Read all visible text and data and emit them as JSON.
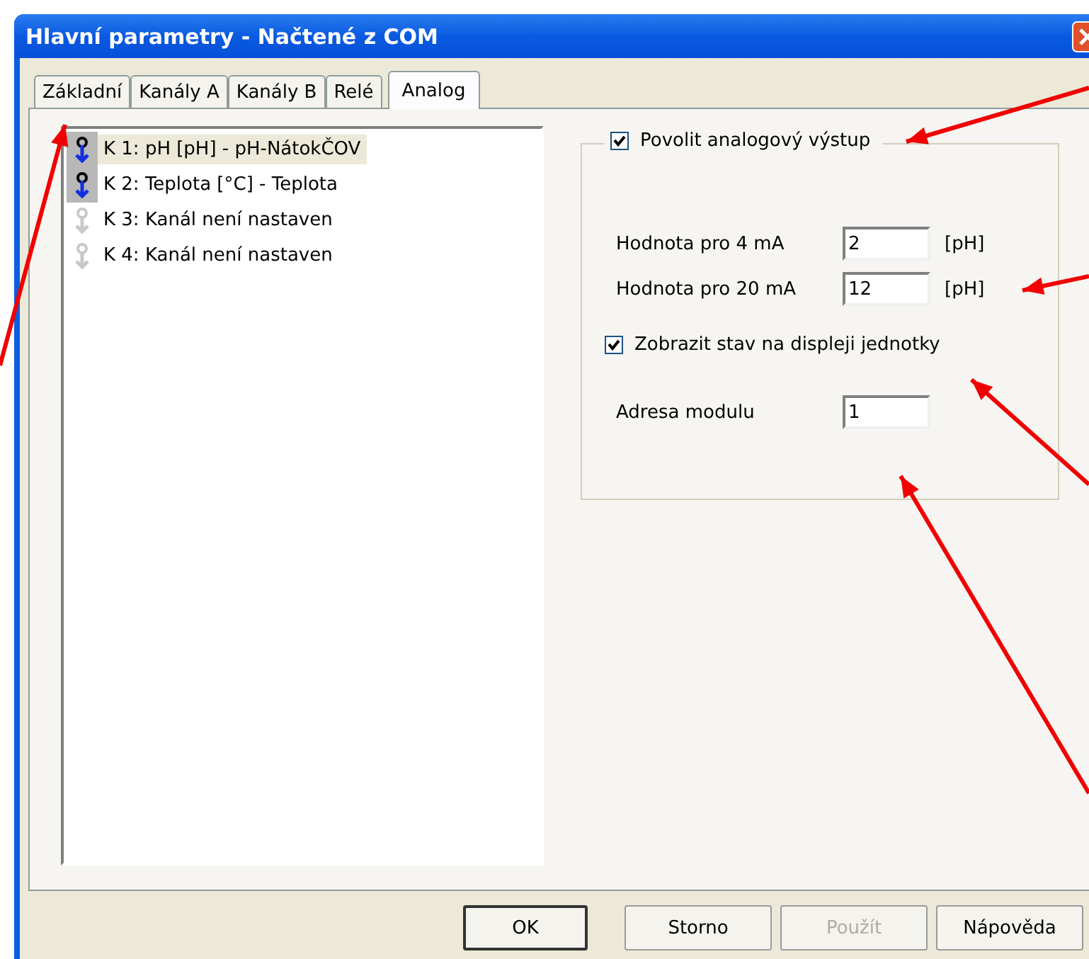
{
  "window": {
    "title": "Hlavní parametry - Načtené z COM"
  },
  "tabs": [
    {
      "label": "Základní",
      "selected": false
    },
    {
      "label": "Kanály A",
      "selected": false
    },
    {
      "label": "Kanály B",
      "selected": false
    },
    {
      "label": "Relé",
      "selected": false
    },
    {
      "label": "Analog",
      "selected": true
    }
  ],
  "channels": [
    {
      "label": "K 1: pH [pH] -  pH-NátokČOV",
      "configured": true,
      "selected": true
    },
    {
      "label": "K 2: Teplota [°C] -  Teplota",
      "configured": true,
      "selected": false
    },
    {
      "label": "K 3: Kanál není nastaven",
      "configured": false,
      "selected": false
    },
    {
      "label": "K 4: Kanál není nastaven",
      "configured": false,
      "selected": false
    }
  ],
  "group": {
    "enable": {
      "label": "Povolit analogový výstup",
      "checked": true
    },
    "fields": [
      {
        "label": "Hodnota pro 4 mA",
        "value": "2",
        "unit": "[pH]"
      },
      {
        "label": "Hodnota pro 20 mA",
        "value": "12",
        "unit": "[pH]"
      }
    ],
    "display": {
      "label": "Zobrazit stav na displeji jednotky",
      "checked": true
    },
    "address": {
      "label": "Adresa modulu",
      "value": "1"
    }
  },
  "buttons": [
    {
      "label": "OK",
      "disabled": false,
      "default": true
    },
    {
      "label": "Storno",
      "disabled": false,
      "default": false
    },
    {
      "label": "Použít",
      "disabled": true,
      "default": false
    },
    {
      "label": "Nápověda",
      "disabled": false,
      "default": false
    }
  ]
}
